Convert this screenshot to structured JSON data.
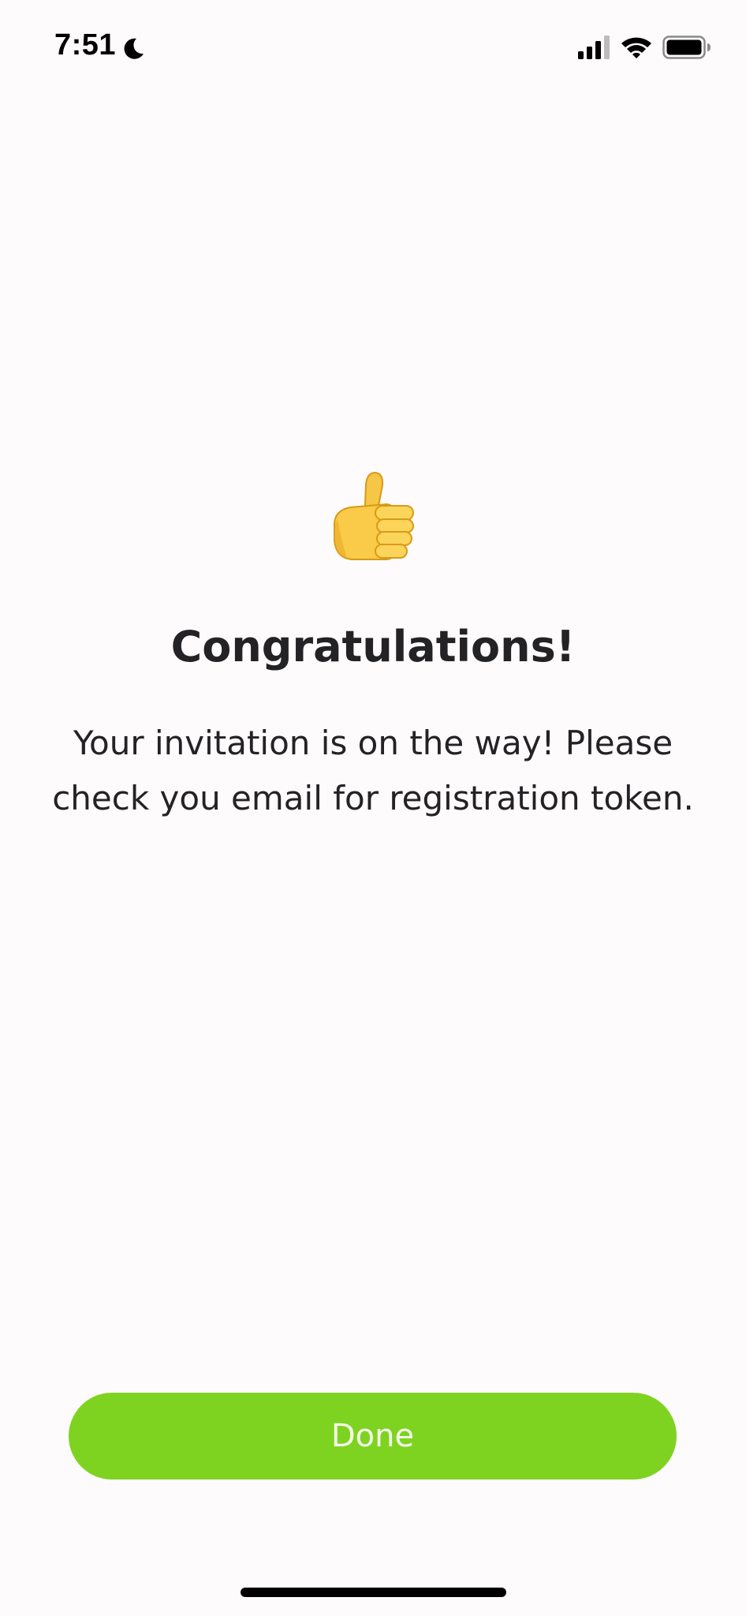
{
  "status_bar": {
    "time": "7:51",
    "icons": [
      "moon-icon",
      "signal-icon",
      "wifi-icon",
      "battery-icon"
    ]
  },
  "content": {
    "icon": "thumbs-up-icon",
    "title": "Congratulations!",
    "message": "Your invitation is on the way! Please check you email for registration token."
  },
  "actions": {
    "done_label": "Done"
  },
  "colors": {
    "background": "#fefbfc",
    "accent": "#7ed321",
    "text": "#232225"
  }
}
